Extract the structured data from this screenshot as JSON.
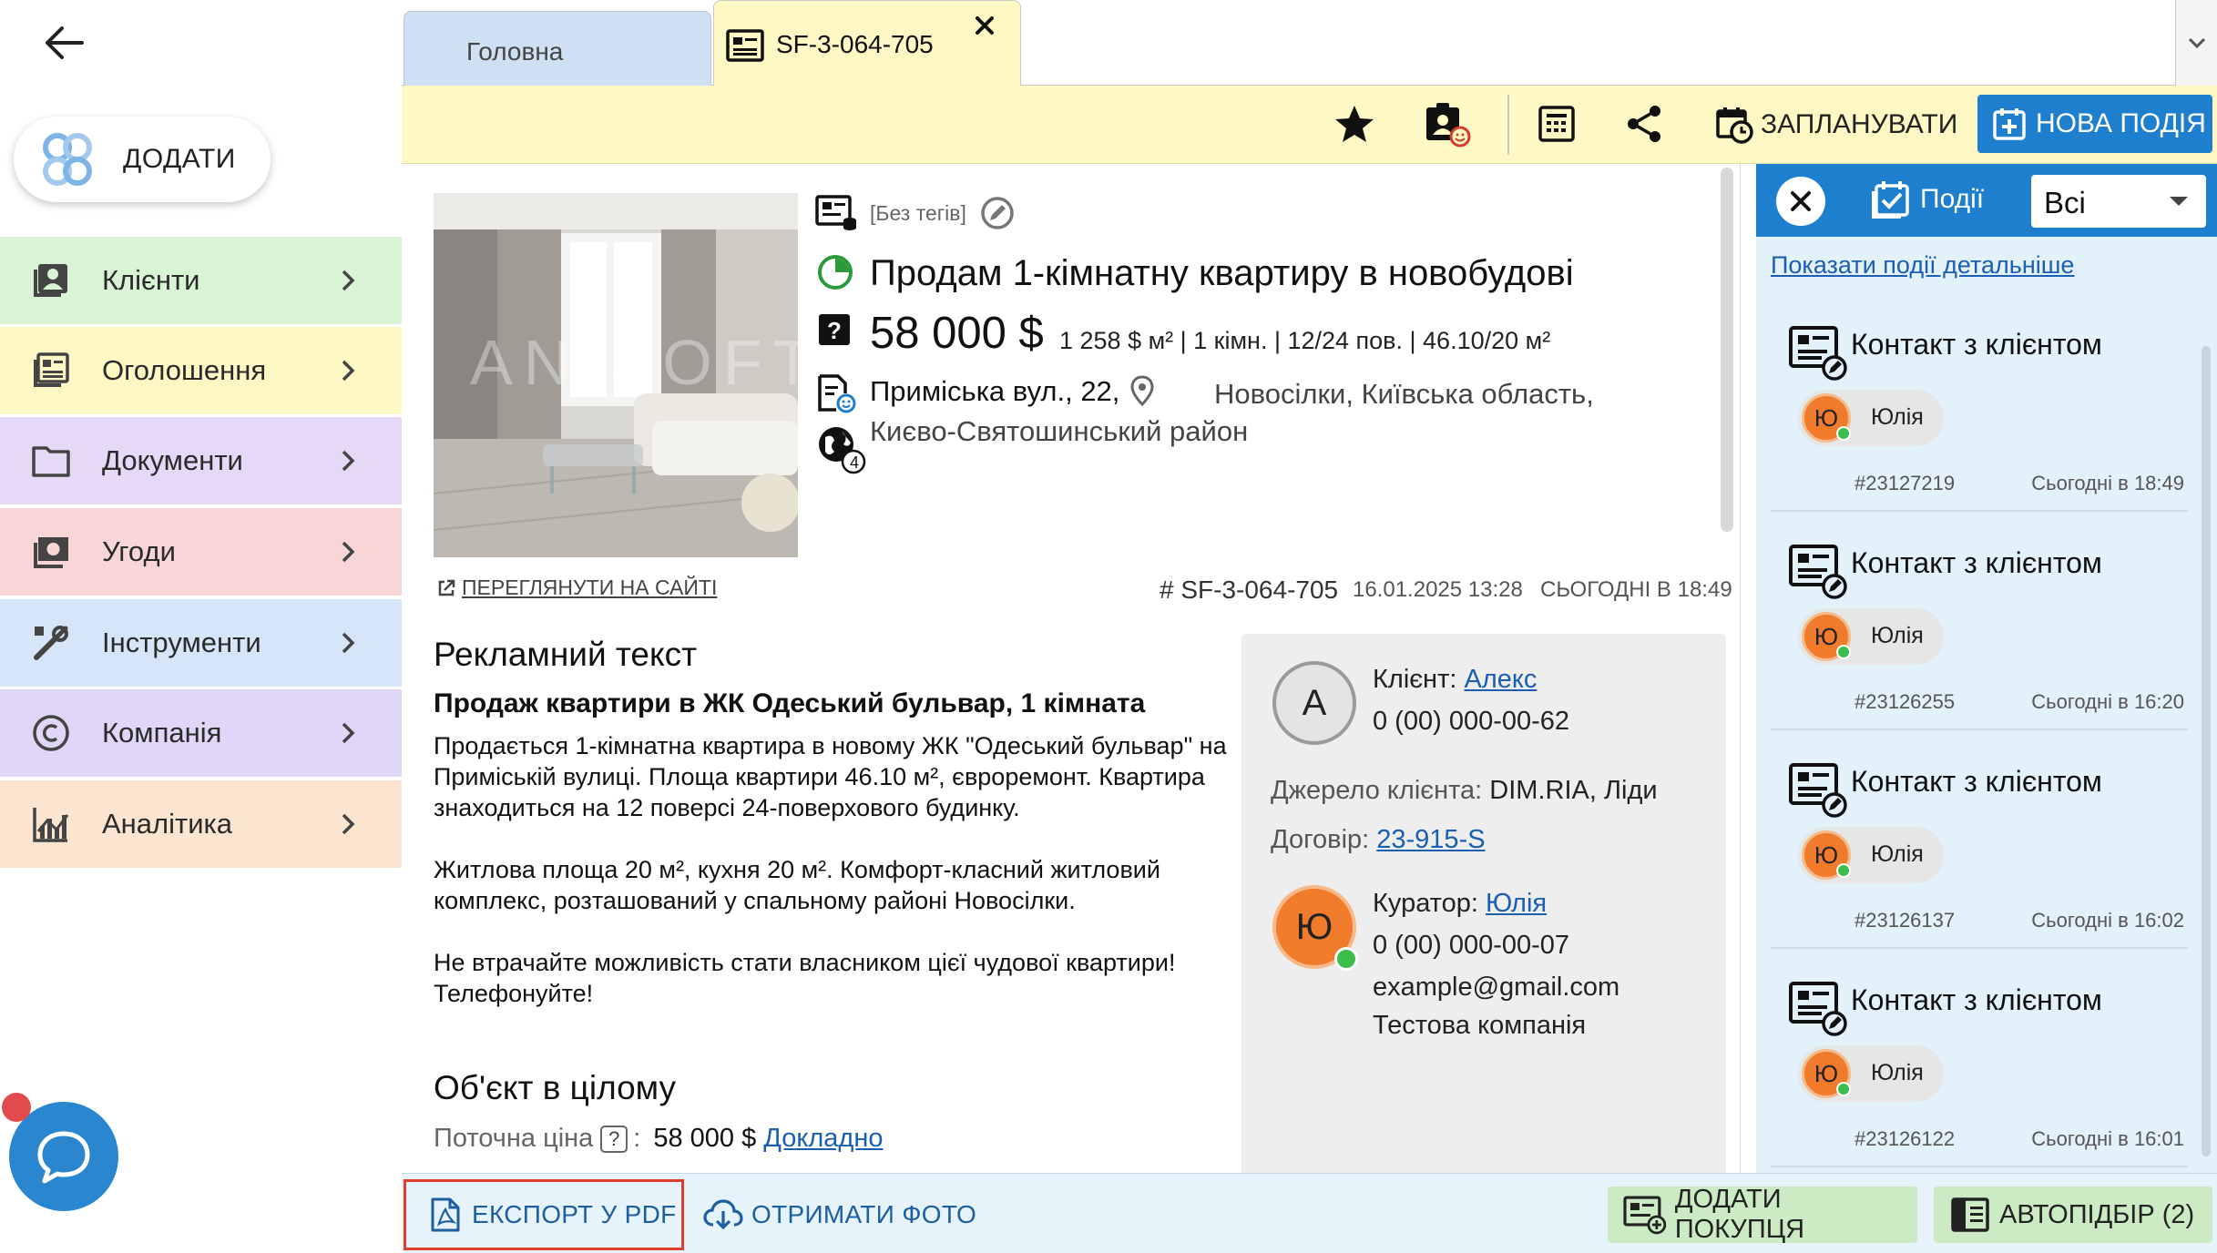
{
  "sidebar": {
    "add_label": "ДОДАТИ",
    "items": [
      {
        "label": "Клієнти",
        "color": "#d9f4d4"
      },
      {
        "label": "Оголошення",
        "color": "#fdf8c4"
      },
      {
        "label": "Документи",
        "color": "#e6d9f7"
      },
      {
        "label": "Угоди",
        "color": "#f8d6d6"
      },
      {
        "label": "Інструменти",
        "color": "#d6e6f8"
      },
      {
        "label": "Компанія",
        "color": "#e0d6f7"
      },
      {
        "label": "Аналітика",
        "color": "#fbe4d0"
      }
    ]
  },
  "tabs": {
    "home": "Головна",
    "object": "SF-3-064-705"
  },
  "toolbar": {
    "plan_label": "ЗАПЛАНУВАТИ",
    "new_event_label": "НОВА ПОДІЯ"
  },
  "object": {
    "tags": "[Без тегів]",
    "title": "Продам 1-кімнатну квартиру в новобудові",
    "price": "58 000 $",
    "price_details": "1 258 $ м² | 1 кімн. | 12/24 пов. | 46.10/20 м²",
    "street": "Приміська вул., 22,",
    "region": "Новосілки, Київська область, Києво-Святошинський район",
    "globe_badge": "4",
    "view_site": "ПЕРЕГЛЯНУТИ НА САЙТІ",
    "id": "# SF-3-064-705",
    "created": "16.01.2025 13:28",
    "updated": "СЬОГОДНІ В 18:49"
  },
  "ad": {
    "heading": "Рекламний текст",
    "subheading": "Продаж квартири в ЖК Одеський бульвар, 1 кімната",
    "p1": "Продається 1-кімнатна квартира в новому ЖК \"Одеський бульвар\" на Приміській вулиці. Площа квартири 46.10 м², євроремонт. Квартира знаходиться на 12 поверсі 24-поверхового будинку.",
    "p2": "Житлова площа 20 м², кухня 20 м². Комфорт-класний житловий комплекс, розташований у спальному районі Новосілки.",
    "p3": "Не втрачайте можливість стати власником цієї чудової квартири! Телефонуйте!"
  },
  "object_summary": {
    "heading": "Об'єкт в цілому",
    "current_price_label": "Поточна ціна",
    "help_glyph": "?",
    "colon": ":",
    "current_price_value": "58 000 $",
    "details_link": "Докладно"
  },
  "contact": {
    "client_initial": "А",
    "client_label": "Клієнт:",
    "client_name": "Алекс",
    "client_phone": "0 (00) 000-00-62",
    "source_label": "Джерело клієнта:",
    "source_value": "DIM.RIA, Ліди",
    "contract_label": "Договір:",
    "contract_value": "23-915-S",
    "curator_initial": "Ю",
    "curator_label": "Куратор:",
    "curator_name": "Юлія",
    "curator_phone": "0 (00) 000-00-07",
    "curator_email": "example@gmail.com",
    "curator_company": "Тестова компанія"
  },
  "events": {
    "title": "Події",
    "filter": "Всі",
    "show_details": "Показати події детальніше",
    "items": [
      {
        "title": "Контакт з клієнтом",
        "user_initial": "Ю",
        "user": "Юлія",
        "id": "#23127219",
        "time": "Сьогодні в 18:49"
      },
      {
        "title": "Контакт з клієнтом",
        "user_initial": "Ю",
        "user": "Юлія",
        "id": "#23126255",
        "time": "Сьогодні в 16:20"
      },
      {
        "title": "Контакт з клієнтом",
        "user_initial": "Ю",
        "user": "Юлія",
        "id": "#23126137",
        "time": "Сьогодні в 16:02"
      },
      {
        "title": "Контакт з клієнтом",
        "user_initial": "Ю",
        "user": "Юлія",
        "id": "#23126122",
        "time": "Сьогодні в 16:01"
      }
    ]
  },
  "bottombar": {
    "export_label": "ЕКСПОРТ У PDF",
    "photos_label": "ОТРИМАТИ ФОТО",
    "add_purchase_label": "ДОДАТИ ПОКУПЦЯ",
    "autoselect_label": "АВТОПІДБІР (2)"
  },
  "colors": {
    "accent": "#1e7fcf",
    "tab_active": "#fdf8c4",
    "tab_home": "#cfe0f3",
    "highlight": "#e23c2c",
    "avatar": "#f07b2a",
    "online": "#3dbd4a",
    "green_button": "#ccebc4"
  },
  "icons": [
    "back-arrow-icon",
    "logo-icon",
    "clients-icon",
    "listings-icon",
    "folder-icon",
    "deals-icon",
    "tools-icon",
    "copyright-icon",
    "analytics-icon",
    "chevron-right-icon",
    "chat-icon",
    "listing-icon",
    "close-icon",
    "chevron-down-icon",
    "star-icon",
    "contact-card-icon",
    "calculator-icon",
    "share-icon",
    "calendar-clock-icon",
    "calendar-plus-icon",
    "object-db-icon",
    "edit-icon",
    "status-pie-icon",
    "question-icon",
    "address-icon",
    "location-pin-icon",
    "globe-icon",
    "external-link-icon",
    "events-icon",
    "event-contact-icon",
    "pdf-icon",
    "cloud-download-icon",
    "add-buyer-icon",
    "autoselect-icon"
  ]
}
